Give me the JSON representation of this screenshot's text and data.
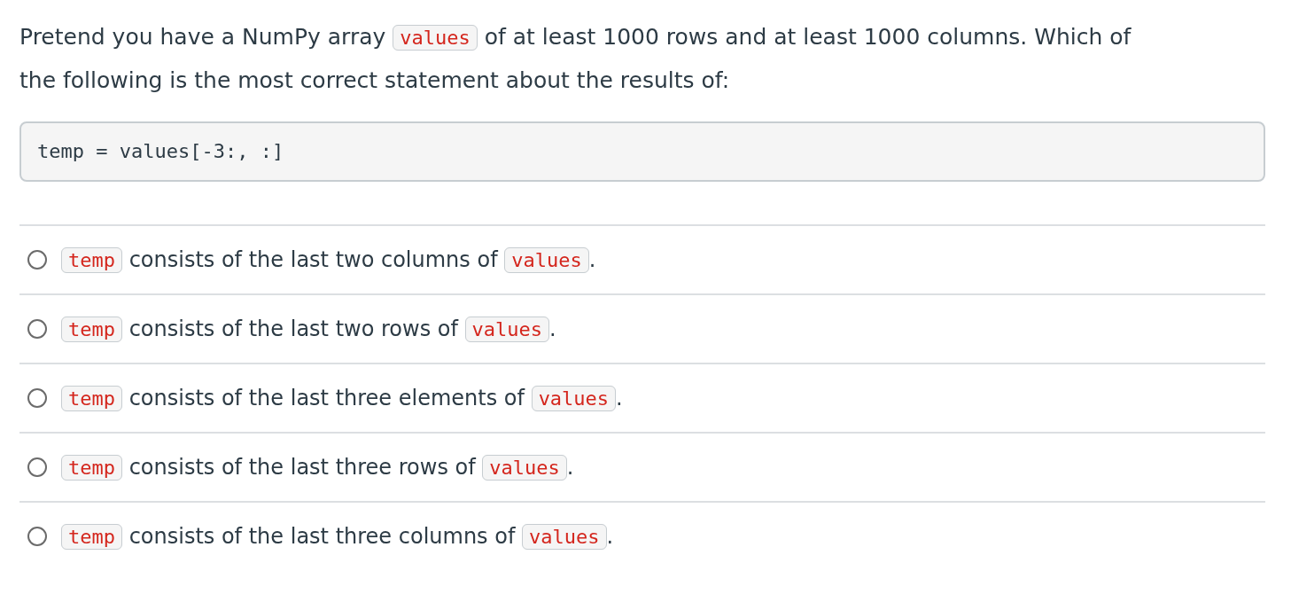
{
  "question": {
    "segments": [
      {
        "kind": "text",
        "text": "Pretend you have a NumPy array"
      },
      {
        "kind": "code",
        "text": "values"
      },
      {
        "kind": "text",
        "text": "of at least 1000 rows and at least 1000 columns. Which of"
      },
      {
        "kind": "text",
        "text": "the following is the most correct statement about the results of:"
      }
    ]
  },
  "code_block": "temp = values[-3:, :]",
  "answers": [
    {
      "selected": false,
      "segments": [
        {
          "kind": "code",
          "text": "temp"
        },
        {
          "kind": "text",
          "text": "consists of the last two columns of"
        },
        {
          "kind": "code",
          "text": "values"
        },
        {
          "kind": "text",
          "text": "."
        }
      ]
    },
    {
      "selected": false,
      "segments": [
        {
          "kind": "code",
          "text": "temp"
        },
        {
          "kind": "text",
          "text": "consists of the last two rows of"
        },
        {
          "kind": "code",
          "text": "values"
        },
        {
          "kind": "text",
          "text": "."
        }
      ]
    },
    {
      "selected": false,
      "segments": [
        {
          "kind": "code",
          "text": "temp"
        },
        {
          "kind": "text",
          "text": "consists of the last three elements of"
        },
        {
          "kind": "code",
          "text": "values"
        },
        {
          "kind": "text",
          "text": "."
        }
      ]
    },
    {
      "selected": false,
      "segments": [
        {
          "kind": "code",
          "text": "temp"
        },
        {
          "kind": "text",
          "text": "consists of the last three rows of"
        },
        {
          "kind": "code",
          "text": "values"
        },
        {
          "kind": "text",
          "text": "."
        }
      ]
    },
    {
      "selected": false,
      "segments": [
        {
          "kind": "code",
          "text": "temp"
        },
        {
          "kind": "text",
          "text": "consists of the last three columns of"
        },
        {
          "kind": "code",
          "text": "values"
        },
        {
          "kind": "text",
          "text": "."
        }
      ]
    }
  ]
}
